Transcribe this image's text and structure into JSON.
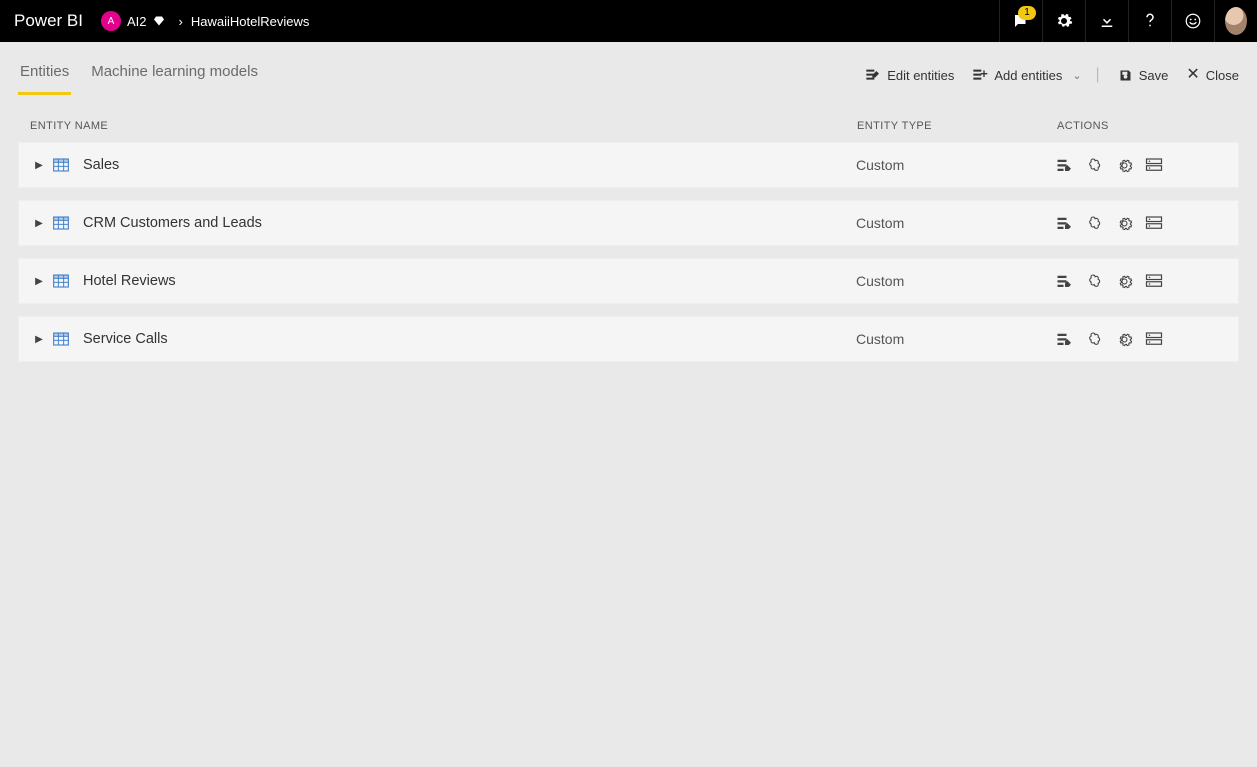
{
  "header": {
    "brand": "Power BI",
    "workspace_initial": "A",
    "workspace_name": "AI2",
    "breadcrumb_item": "HawaiiHotelReviews",
    "notification_badge": "1"
  },
  "tabs": {
    "entities": "Entities",
    "ml_models": "Machine learning models"
  },
  "commands": {
    "edit_entities": "Edit entities",
    "add_entities": "Add entities",
    "save": "Save",
    "close": "Close"
  },
  "grid": {
    "col_name": "ENTITY NAME",
    "col_type": "ENTITY TYPE",
    "col_actions": "ACTIONS"
  },
  "action_icons": [
    "table-edit-icon",
    "brain-icon",
    "gear-icon",
    "server-icon"
  ],
  "entities": [
    {
      "name": "Sales",
      "type": "Custom"
    },
    {
      "name": "CRM Customers and Leads",
      "type": "Custom"
    },
    {
      "name": "Hotel Reviews",
      "type": "Custom"
    },
    {
      "name": "Service Calls",
      "type": "Custom"
    }
  ]
}
